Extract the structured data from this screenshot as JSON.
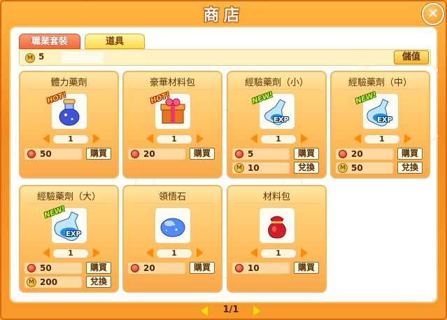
{
  "window": {
    "title": "商店",
    "close_glyph": "✕"
  },
  "tabs": [
    {
      "label": "職業套裝",
      "active": false
    },
    {
      "label": "道具",
      "active": true
    }
  ],
  "wallet": {
    "coin_icon": "coin-icon",
    "amount": "5"
  },
  "store_button": "儲值",
  "items": [
    {
      "name": "體力藥劑",
      "badge": "HOT!",
      "icon": "potion-bottle-icon",
      "quantity": "1",
      "prices": [
        {
          "currency": "gem",
          "value": "50",
          "action": "購買"
        }
      ]
    },
    {
      "name": "豪華材料包",
      "badge": "HOT!",
      "icon": "gift-box-icon",
      "quantity": "1",
      "prices": [
        {
          "currency": "gem",
          "value": "20",
          "action": "購買"
        }
      ]
    },
    {
      "name": "經驗藥劑（小）",
      "badge": "NEW!",
      "icon": "exp-potion-small-icon",
      "quantity": "1",
      "prices": [
        {
          "currency": "gem",
          "value": "5",
          "action": "購買"
        },
        {
          "currency": "coin",
          "value": "10",
          "action": "兌換"
        }
      ]
    },
    {
      "name": "經驗藥劑（中）",
      "badge": "NEW!",
      "icon": "exp-potion-medium-icon",
      "quantity": "1",
      "prices": [
        {
          "currency": "gem",
          "value": "20",
          "action": "購買"
        },
        {
          "currency": "coin",
          "value": "50",
          "action": "兌換"
        }
      ]
    },
    {
      "name": "經驗藥劑（大）",
      "badge": "NEW!",
      "icon": "exp-potion-large-icon",
      "quantity": "1",
      "prices": [
        {
          "currency": "gem",
          "value": "50",
          "action": "購買"
        },
        {
          "currency": "coin",
          "value": "200",
          "action": "兌換"
        }
      ]
    },
    {
      "name": "領悟石",
      "badge": "",
      "icon": "blue-stone-icon",
      "quantity": "1",
      "prices": [
        {
          "currency": "gem",
          "value": "20",
          "action": "購買"
        }
      ]
    },
    {
      "name": "材料包",
      "badge": "",
      "icon": "red-pouch-icon",
      "quantity": "1",
      "prices": [
        {
          "currency": "gem",
          "value": "10",
          "action": "購買"
        }
      ]
    }
  ],
  "exp_label": "EXP",
  "coin_glyph": "M",
  "pager": {
    "text": "1/1"
  },
  "colors": {
    "accent": "#f48a1e",
    "arrow": "#ff8a00",
    "gem": "#d8200a",
    "coin": "#d99800"
  }
}
